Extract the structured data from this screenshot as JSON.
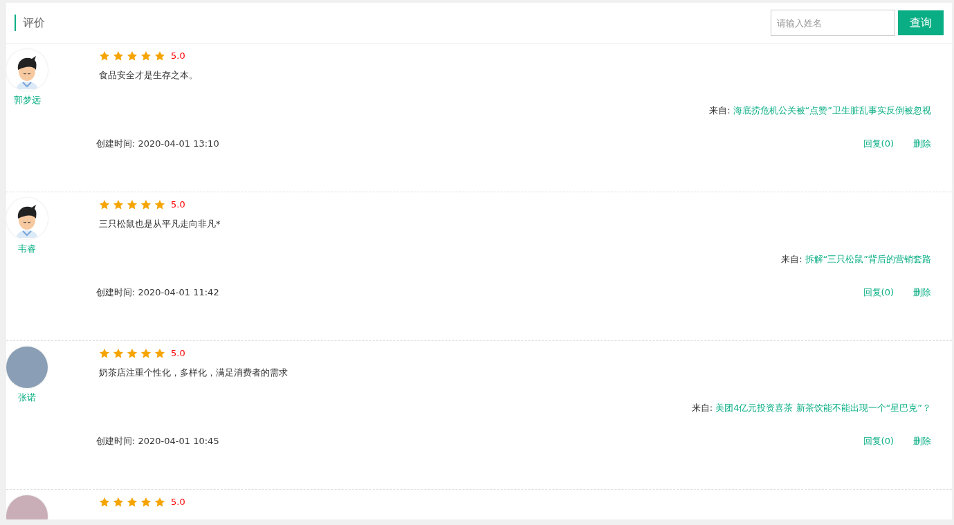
{
  "header": {
    "title": "评价",
    "search": {
      "placeholder": "请输入姓名"
    },
    "search_button": "查询"
  },
  "reviews": [
    {
      "avatar": {
        "kind": "cartoon"
      },
      "name": "郭梦远",
      "stars": 5,
      "rating": "5.0",
      "text": "食品安全才是生存之本。",
      "source_label": "来自:",
      "source": "海底捞危机公关被“点赞”卫生脏乱事实反倒被忽视",
      "created": "创建时间: 2020-04-01 13:10",
      "reply": "回复(0)",
      "delete": "删除"
    },
    {
      "avatar": {
        "kind": "cartoon"
      },
      "name": "韦睿",
      "stars": 5,
      "rating": "5.0",
      "text": "三只松鼠也是从平凡走向非凡*",
      "source_label": "来自:",
      "source": "拆解“三只松鼠”背后的营销套路",
      "created": "创建时间: 2020-04-01 11:42",
      "reply": "回复(0)",
      "delete": "删除"
    },
    {
      "avatar": {
        "kind": "photo"
      },
      "name": "张诺",
      "stars": 5,
      "rating": "5.0",
      "text": "奶茶店注重个性化，多样化，满足消费者的需求",
      "source_label": "来自:",
      "source": "美团4亿元投资喜茶 新茶饮能不能出现一个“星巴克”？",
      "created": "创建时间: 2020-04-01 10:45",
      "reply": "回复(0)",
      "delete": "删除"
    },
    {
      "avatar": {
        "kind": "photo"
      },
      "stars": 5,
      "rating": "5.0"
    }
  ]
}
